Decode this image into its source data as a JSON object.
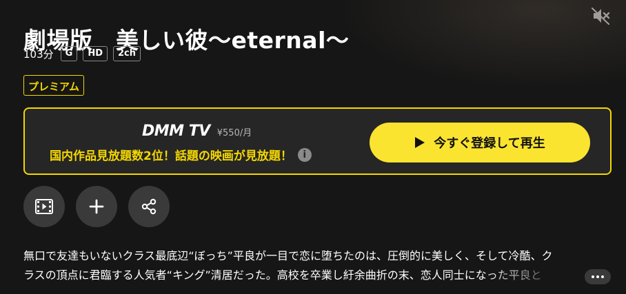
{
  "title": "劇場版　美しい彼～eternal～",
  "meta": {
    "duration": "103分",
    "badges": [
      "G",
      "HD",
      "2ch"
    ]
  },
  "premium_label": "プレミアム",
  "promo": {
    "brand": "DMM TV",
    "price": "¥550/月",
    "message": "国内作品見放題数2位！話題の映画が見放題！",
    "info_icon": "i",
    "cta_label": "今すぐ登録して再生"
  },
  "icons": {
    "mute": "speaker-muted-icon",
    "play": "play-icon",
    "trailer": "film-icon",
    "add": "plus-icon",
    "share": "share-icon",
    "more": "ellipsis-icon"
  },
  "colors": {
    "background": "#161616",
    "accent": "#f5d800",
    "cta": "#fbe42f",
    "button_dark": "#3a3a3a"
  },
  "synopsis": {
    "line1": "無口で友達もいないクラス最底辺“ぼっち”平良が一目で恋に堕ちたのは、圧倒的に美しく、そして冷酷、ク",
    "line2": "ラスの頂点に君臨する人気者“キング”清居だった。高校を卒業し紆余曲折の末、恋人同士になった平良と"
  }
}
